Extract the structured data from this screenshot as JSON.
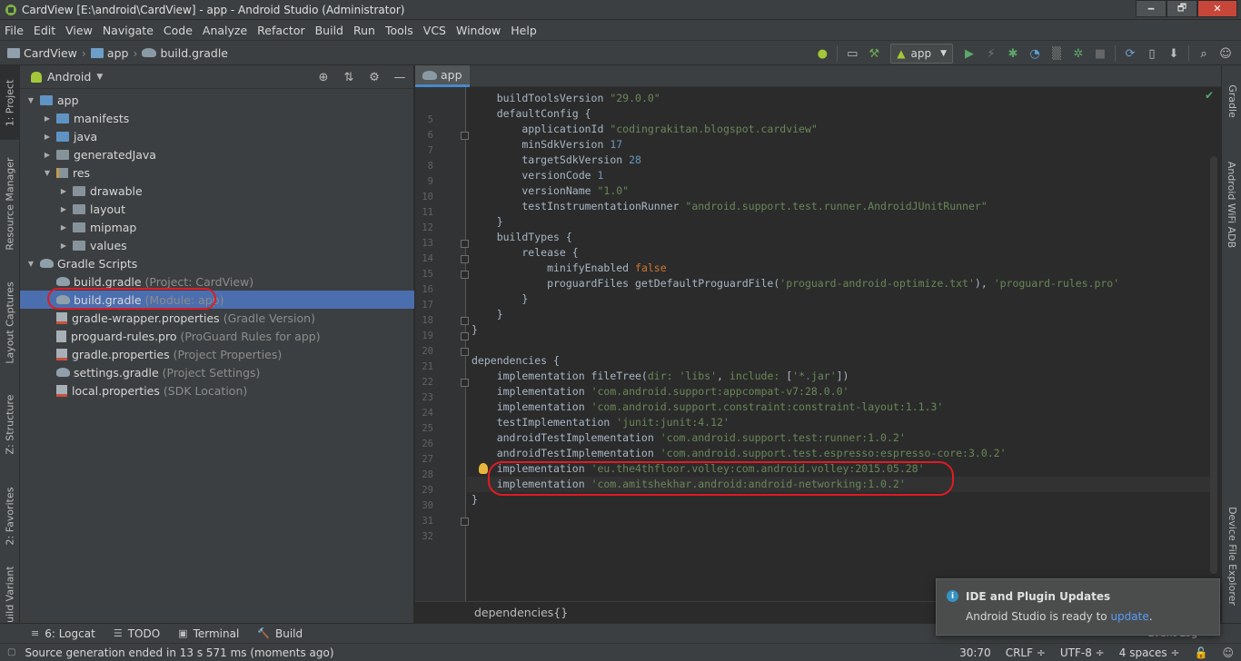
{
  "window": {
    "title": "CardView [E:\\android\\CardView] - app - Android Studio (Administrator)",
    "minimize": "🗕",
    "maximize": "🗗",
    "close": "✕"
  },
  "menu": [
    "File",
    "Edit",
    "View",
    "Navigate",
    "Code",
    "Analyze",
    "Refactor",
    "Build",
    "Run",
    "Tools",
    "VCS",
    "Window",
    "Help"
  ],
  "nav": {
    "crumbs": [
      "CardView",
      "app",
      "build.gradle"
    ],
    "run_config": "app"
  },
  "left_tabs": [
    "1: Project",
    "Resource Manager",
    "Layout Captures",
    "Z: Structure",
    "2: Favorites",
    "Build Variants"
  ],
  "right_tabs": [
    "Gradle",
    "Android WiFi ADB",
    "Device File Explorer"
  ],
  "project_panel": {
    "view": "Android",
    "tree": [
      {
        "label": "app",
        "hint": "",
        "depth": 0,
        "icon": "folder-blue",
        "expanded": true
      },
      {
        "label": "manifests",
        "hint": "",
        "depth": 1,
        "icon": "folder-blue",
        "expanded": false
      },
      {
        "label": "java",
        "hint": "",
        "depth": 1,
        "icon": "folder-blue",
        "expanded": false
      },
      {
        "label": "generatedJava",
        "hint": "",
        "depth": 1,
        "icon": "folder-gen",
        "expanded": false
      },
      {
        "label": "res",
        "hint": "",
        "depth": 1,
        "icon": "res",
        "expanded": true
      },
      {
        "label": "drawable",
        "hint": "",
        "depth": 2,
        "icon": "folder",
        "expanded": false
      },
      {
        "label": "layout",
        "hint": "",
        "depth": 2,
        "icon": "folder",
        "expanded": false
      },
      {
        "label": "mipmap",
        "hint": "",
        "depth": 2,
        "icon": "folder",
        "expanded": false
      },
      {
        "label": "values",
        "hint": "",
        "depth": 2,
        "icon": "folder",
        "expanded": false
      },
      {
        "label": "Gradle Scripts",
        "hint": "",
        "depth": 0,
        "icon": "gradle",
        "expanded": true
      },
      {
        "label": "build.gradle",
        "hint": "(Project: CardView)",
        "depth": 1,
        "icon": "gradle",
        "expanded": null
      },
      {
        "label": "build.gradle",
        "hint": "(Module: app)",
        "depth": 1,
        "icon": "gradle",
        "expanded": null,
        "selected": true
      },
      {
        "label": "gradle-wrapper.properties",
        "hint": "(Gradle Version)",
        "depth": 1,
        "icon": "props",
        "expanded": null
      },
      {
        "label": "proguard-rules.pro",
        "hint": "(ProGuard Rules for app)",
        "depth": 1,
        "icon": "pro",
        "expanded": null
      },
      {
        "label": "gradle.properties",
        "hint": "(Project Properties)",
        "depth": 1,
        "icon": "props",
        "expanded": null
      },
      {
        "label": "settings.gradle",
        "hint": "(Project Settings)",
        "depth": 1,
        "icon": "gradle",
        "expanded": null
      },
      {
        "label": "local.properties",
        "hint": "(SDK Location)",
        "depth": 1,
        "icon": "props",
        "expanded": null
      }
    ]
  },
  "editor": {
    "tab": "app",
    "lines": [
      {
        "n": "5",
        "tokens": [
          {
            "t": "    buildToolsVersion ",
            "c": ""
          },
          {
            "t": "\"29.0.0\"",
            "c": "str"
          }
        ]
      },
      {
        "n": "6",
        "tokens": [
          {
            "t": "    defaultConfig {",
            "c": ""
          }
        ]
      },
      {
        "n": "7",
        "tokens": [
          {
            "t": "        applicationId ",
            "c": ""
          },
          {
            "t": "\"codingrakitan.blogspot.cardview\"",
            "c": "str"
          }
        ]
      },
      {
        "n": "8",
        "tokens": [
          {
            "t": "        minSdkVersion ",
            "c": ""
          },
          {
            "t": "17",
            "c": "num"
          }
        ]
      },
      {
        "n": "9",
        "tokens": [
          {
            "t": "        targetSdkVersion ",
            "c": ""
          },
          {
            "t": "28",
            "c": "num"
          }
        ]
      },
      {
        "n": "10",
        "tokens": [
          {
            "t": "        versionCode ",
            "c": ""
          },
          {
            "t": "1",
            "c": "num"
          }
        ]
      },
      {
        "n": "11",
        "tokens": [
          {
            "t": "        versionName ",
            "c": ""
          },
          {
            "t": "\"1.0\"",
            "c": "str"
          }
        ]
      },
      {
        "n": "12",
        "tokens": [
          {
            "t": "        testInstrumentationRunner ",
            "c": ""
          },
          {
            "t": "\"android.support.test.runner.AndroidJUnitRunner\"",
            "c": "str"
          }
        ]
      },
      {
        "n": "13",
        "tokens": [
          {
            "t": "    }",
            "c": ""
          }
        ]
      },
      {
        "n": "14",
        "tokens": [
          {
            "t": "    buildTypes {",
            "c": ""
          }
        ]
      },
      {
        "n": "15",
        "tokens": [
          {
            "t": "        release {",
            "c": ""
          }
        ]
      },
      {
        "n": "16",
        "tokens": [
          {
            "t": "            minifyEnabled ",
            "c": ""
          },
          {
            "t": "false",
            "c": "kw"
          }
        ]
      },
      {
        "n": "17",
        "tokens": [
          {
            "t": "            proguardFiles getDefaultProguardFile(",
            "c": ""
          },
          {
            "t": "'proguard-android-optimize.txt'",
            "c": "str"
          },
          {
            "t": "), ",
            "c": ""
          },
          {
            "t": "'proguard-rules.pro'",
            "c": "str"
          }
        ]
      },
      {
        "n": "18",
        "tokens": [
          {
            "t": "        }",
            "c": ""
          }
        ]
      },
      {
        "n": "19",
        "tokens": [
          {
            "t": "    }",
            "c": ""
          }
        ]
      },
      {
        "n": "20",
        "tokens": [
          {
            "t": "}",
            "c": ""
          }
        ]
      },
      {
        "n": "21",
        "tokens": []
      },
      {
        "n": "22",
        "tokens": [
          {
            "t": "dependencies {",
            "c": ""
          }
        ]
      },
      {
        "n": "23",
        "tokens": [
          {
            "t": "    implementation fileTree(",
            "c": ""
          },
          {
            "t": "dir: ",
            "c": "str"
          },
          {
            "t": "'libs'",
            "c": "str"
          },
          {
            "t": ", ",
            "c": ""
          },
          {
            "t": "include: ",
            "c": "str"
          },
          {
            "t": "[",
            "c": ""
          },
          {
            "t": "'*.jar'",
            "c": "str"
          },
          {
            "t": "])",
            "c": ""
          }
        ]
      },
      {
        "n": "24",
        "tokens": [
          {
            "t": "    implementation ",
            "c": ""
          },
          {
            "t": "'com.android.support:appcompat-v7:28.0.0'",
            "c": "str"
          }
        ]
      },
      {
        "n": "25",
        "tokens": [
          {
            "t": "    implementation ",
            "c": ""
          },
          {
            "t": "'com.android.support.constraint:constraint-layout:1.1.3'",
            "c": "str"
          }
        ]
      },
      {
        "n": "26",
        "tokens": [
          {
            "t": "    testImplementation ",
            "c": ""
          },
          {
            "t": "'junit:junit:4.12'",
            "c": "str"
          }
        ]
      },
      {
        "n": "27",
        "tokens": [
          {
            "t": "    androidTestImplementation ",
            "c": ""
          },
          {
            "t": "'com.android.support.test:runner:1.0.2'",
            "c": "str"
          }
        ]
      },
      {
        "n": "28",
        "tokens": [
          {
            "t": "    androidTestImplementation ",
            "c": ""
          },
          {
            "t": "'com.android.support.test.espresso:espresso-core:3.0.2'",
            "c": "str"
          }
        ]
      },
      {
        "n": "29",
        "tokens": [
          {
            "t": "    implementation ",
            "c": ""
          },
          {
            "t": "'eu.the4thfloor.volley:com.android.volley:2015.05.28'",
            "c": "str"
          }
        ]
      },
      {
        "n": "30",
        "tokens": [
          {
            "t": "    implementation ",
            "c": ""
          },
          {
            "t": "'com.amitshekhar.android:android-networking:1.0.2'",
            "c": "str"
          }
        ]
      },
      {
        "n": "31",
        "tokens": [
          {
            "t": "}",
            "c": ""
          }
        ]
      },
      {
        "n": "32",
        "tokens": []
      }
    ],
    "breadcrumb": "dependencies{}"
  },
  "bottom_tools": [
    {
      "icon": "≡",
      "label": "6: Logcat"
    },
    {
      "icon": "☰",
      "label": "TODO"
    },
    {
      "icon": "▣",
      "label": "Terminal"
    },
    {
      "icon": "🔨",
      "label": "Build"
    }
  ],
  "event_log": "Event Log",
  "status": {
    "message": "Source generation ended in 13 s 571 ms (moments ago)",
    "position": "30:70",
    "line_sep": "CRLF ÷",
    "encoding": "UTF-8 ÷",
    "indent": "4 spaces ÷"
  },
  "notification": {
    "title": "IDE and Plugin Updates",
    "body": "Android Studio is ready to ",
    "link": "update",
    "suffix": "."
  },
  "colors": {
    "accent": "#4b6eaf",
    "string": "#6a8759",
    "number": "#6897bb",
    "keyword": "#cc7832",
    "annotation_red": "#e01b24"
  }
}
